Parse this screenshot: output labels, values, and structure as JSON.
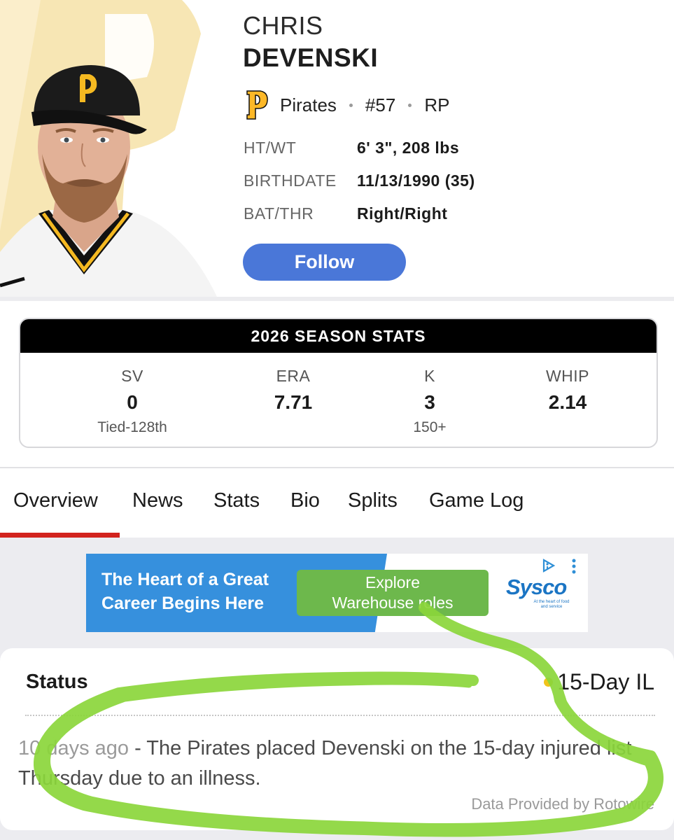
{
  "player": {
    "first_name": "CHRIS",
    "last_name": "DEVENSKI",
    "team": "Pirates",
    "number": "#57",
    "position": "RP",
    "details": [
      {
        "label": "HT/WT",
        "value": "6' 3\", 208 lbs"
      },
      {
        "label": "BIRTHDATE",
        "value": "11/13/1990 (35)"
      },
      {
        "label": "BAT/THR",
        "value": "Right/Right"
      }
    ],
    "follow_label": "Follow",
    "team_logo_icon": "pirates-p-logo",
    "colors": {
      "gold": "#FDB827",
      "black": "#111111",
      "follow_blue": "#4A77D8"
    }
  },
  "season_stats": {
    "title": "2026 SEASON STATS",
    "stats": [
      {
        "abbr": "SV",
        "value": "0",
        "rank": "Tied-128th"
      },
      {
        "abbr": "ERA",
        "value": "7.71",
        "rank": ""
      },
      {
        "abbr": "K",
        "value": "3",
        "rank": "150+"
      },
      {
        "abbr": "WHIP",
        "value": "2.14",
        "rank": ""
      }
    ]
  },
  "tabs": [
    "Overview",
    "News",
    "Stats",
    "Bio",
    "Splits",
    "Game Log"
  ],
  "active_tab": "Overview",
  "ad": {
    "headline_line1": "The Heart of a Great",
    "headline_line2": "Career Begins Here",
    "cta_line1": "Explore",
    "cta_line2": "Warehouse roles",
    "brand": "Sysco",
    "brand_tagline": "At the heart of food and service",
    "colors": {
      "blue": "#3690DD",
      "green": "#6DB84C"
    }
  },
  "status": {
    "title": "Status",
    "value": "15-Day IL",
    "dot_color": "#F0C41B",
    "news_time": "10 days ago",
    "news_text": " - The Pirates placed Devenski on the 15-day injured list Thursday due to an illness.",
    "credit": "Data Provided by Rotowire"
  },
  "annotation": {
    "color": "#8BD63B",
    "shape": "hand-drawn loop around status"
  }
}
